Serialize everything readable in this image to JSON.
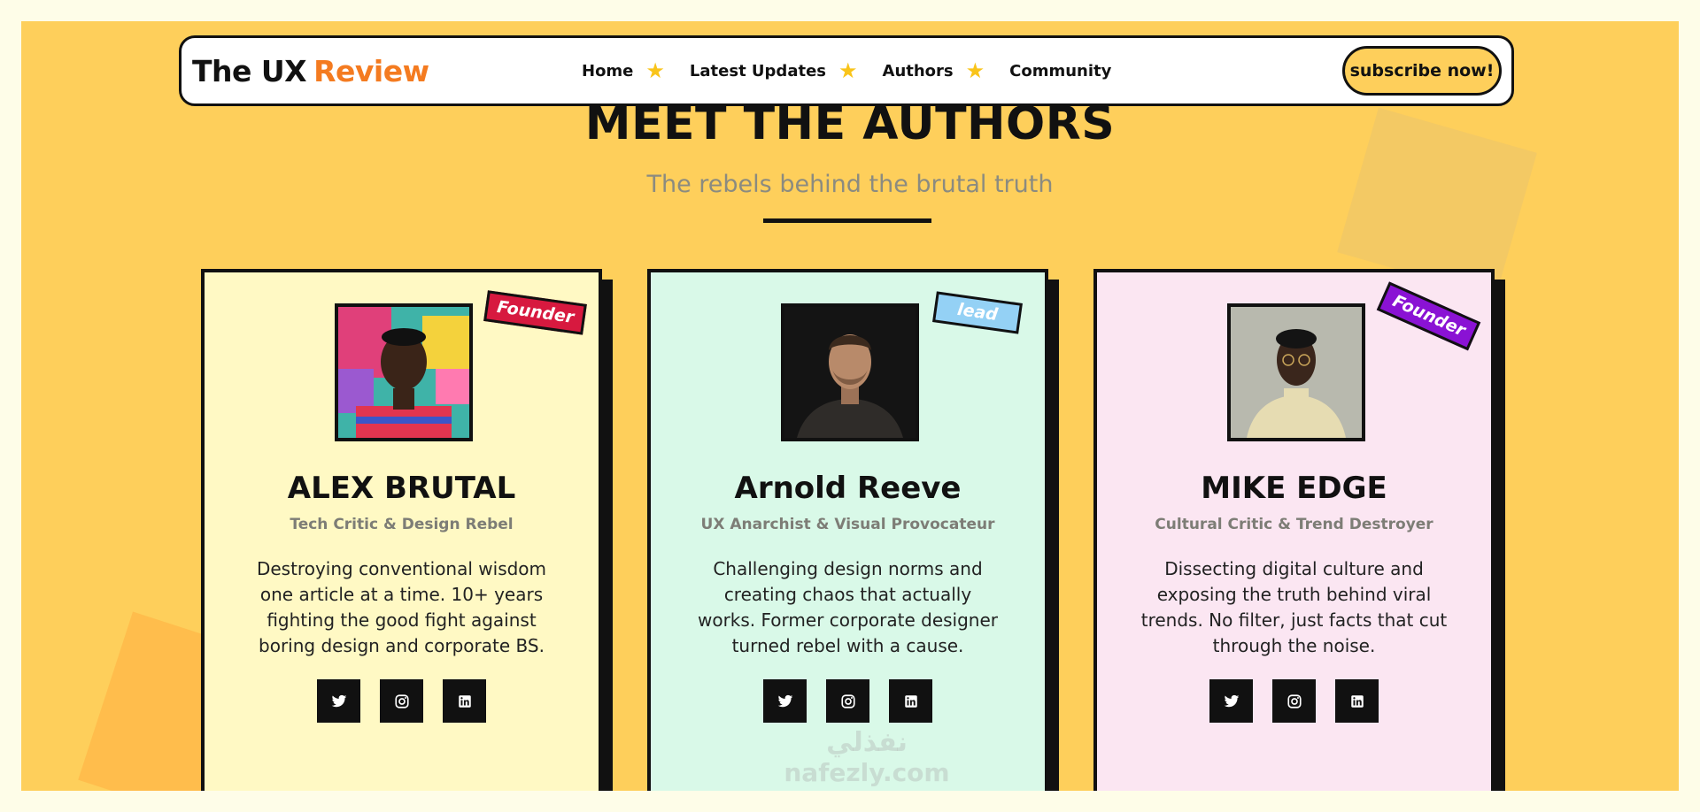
{
  "nav": {
    "logo_part1": "The UX",
    "logo_part2": "Review",
    "items": [
      {
        "label": "Home",
        "icon": "star-icon"
      },
      {
        "label": "Latest Updates",
        "icon": "star-icon"
      },
      {
        "label": "Authors",
        "icon": "star-icon"
      },
      {
        "label": "Community"
      }
    ],
    "subscribe_label": "subscribe now!"
  },
  "hero": {
    "title": "MEET THE AUTHORS",
    "subtitle": "The rebels behind the brutal truth"
  },
  "authors": [
    {
      "badge": "Founder",
      "badge_color": "#D7193F",
      "card_bg": "#FFF9C4",
      "name": "ALEX BRUTAL",
      "role": "Tech Critic & Design Rebel",
      "bio": "Destroying conventional wisdom one article at a time. 10+ years fighting the good fight against boring design and corporate BS.",
      "socials": [
        "twitter-icon",
        "instagram-icon",
        "linkedin-icon"
      ]
    },
    {
      "badge": "lead",
      "badge_color": "#94D1F5",
      "card_bg": "#D9F9E8",
      "name": "Arnold Reeve",
      "role": "UX Anarchist & Visual Provocateur",
      "bio": "Challenging design norms and creating chaos that actually works. Former corporate designer turned rebel with a cause.",
      "socials": [
        "twitter-icon",
        "instagram-icon",
        "linkedin-icon"
      ]
    },
    {
      "badge": "Founder",
      "badge_color": "#8A12D4",
      "card_bg": "#FBE6F2",
      "name": "MIKE EDGE",
      "role": "Cultural Critic & Trend Destroyer",
      "bio": "Dissecting digital culture and exposing the truth behind viral trends. No filter, just facts that cut through the noise.",
      "socials": [
        "twitter-icon",
        "instagram-icon",
        "linkedin-icon"
      ]
    }
  ],
  "colors": {
    "page_bg": "#FEFDE8",
    "stage_bg": "#FECF5B",
    "accent": "#F47B20",
    "star": "#F9C41A",
    "ink": "#111111"
  },
  "watermark": {
    "arabic": "نفذلي",
    "latin": "nafezly.com"
  }
}
